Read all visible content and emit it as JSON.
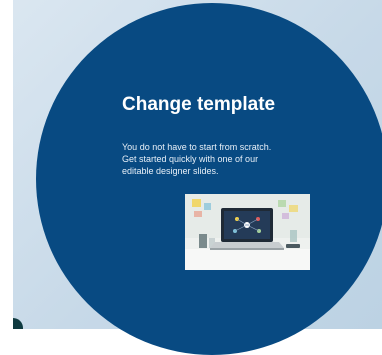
{
  "slide": {
    "title": "Change template",
    "description_lines": [
      "You do not have to start from scratch.",
      "Get started quickly with one of our",
      "editable designer slides."
    ]
  },
  "image": {
    "icon": "laptop-desk-photo"
  },
  "colors": {
    "circle": "#084a82",
    "background": "#cbdcea",
    "text": "#ffffff"
  }
}
